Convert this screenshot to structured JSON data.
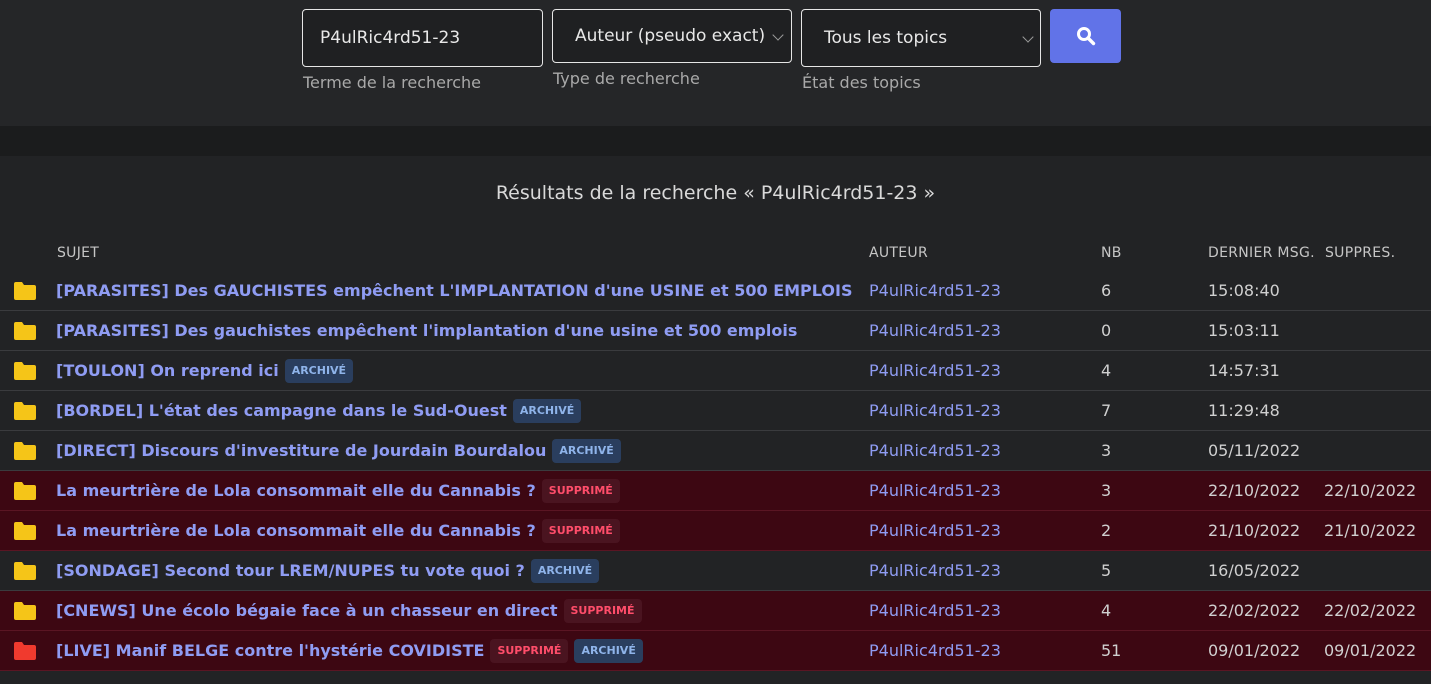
{
  "search": {
    "term_value": "P4ulRic4rd51-23",
    "term_caption": "Terme de la recherche",
    "type_value": "Auteur (pseudo exact)",
    "type_caption": "Type de recherche",
    "state_value": "Tous les topics",
    "state_caption": "État des topics",
    "button_icon": "search-icon"
  },
  "results": {
    "title": "Résultats de la recherche « P4ulRic4rd51-23 »",
    "headers": {
      "subject": "SUJET",
      "author": "AUTEUR",
      "nb": "NB",
      "last": "DERNIER MSG.",
      "deleted": "SUPPRES."
    },
    "rows": [
      {
        "subject": "[PARASITES] Des GAUCHISTES empêchent L'IMPLANTATION d'une USINE et 500 EMPLOIS",
        "author": "P4ulRic4rd51-23",
        "nb": "6",
        "last": "15:08:40",
        "deleted_date": "",
        "badges": [],
        "deleted": false,
        "folder_color": "#f5c518"
      },
      {
        "subject": "[PARASITES] Des gauchistes empêchent l'implantation d'une usine et 500 emplois",
        "author": "P4ulRic4rd51-23",
        "nb": "0",
        "last": "15:03:11",
        "deleted_date": "",
        "badges": [],
        "deleted": false,
        "folder_color": "#f5c518"
      },
      {
        "subject": "[TOULON] On reprend ici",
        "author": "P4ulRic4rd51-23",
        "nb": "4",
        "last": "14:57:31",
        "deleted_date": "",
        "badges": [
          "ARCHIVÉ"
        ],
        "deleted": false,
        "folder_color": "#f5c518"
      },
      {
        "subject": "[BORDEL] L'état des campagne dans le Sud-Ouest",
        "author": "P4ulRic4rd51-23",
        "nb": "7",
        "last": "11:29:48",
        "deleted_date": "",
        "badges": [
          "ARCHIVÉ"
        ],
        "deleted": false,
        "folder_color": "#f5c518"
      },
      {
        "subject": "[DIRECT] Discours d'investiture de Jourdain Bourdalou",
        "author": "P4ulRic4rd51-23",
        "nb": "3",
        "last": "05/11/2022",
        "deleted_date": "",
        "badges": [
          "ARCHIVÉ"
        ],
        "deleted": false,
        "folder_color": "#f5c518"
      },
      {
        "subject": "La meurtrière de Lola consommait elle du Cannabis ?",
        "author": "P4ulRic4rd51-23",
        "nb": "3",
        "last": "22/10/2022",
        "deleted_date": "22/10/2022",
        "badges": [
          "SUPPRIMÉ"
        ],
        "deleted": true,
        "folder_color": "#f5c518"
      },
      {
        "subject": "La meurtrière de Lola consommait elle du Cannabis ?",
        "author": "P4ulRic4rd51-23",
        "nb": "2",
        "last": "21/10/2022",
        "deleted_date": "21/10/2022",
        "badges": [
          "SUPPRIMÉ"
        ],
        "deleted": true,
        "folder_color": "#f5c518"
      },
      {
        "subject": "[SONDAGE] Second tour LREM/NUPES tu vote quoi ?",
        "author": "P4ulRic4rd51-23",
        "nb": "5",
        "last": "16/05/2022",
        "deleted_date": "",
        "badges": [
          "ARCHIVÉ"
        ],
        "deleted": false,
        "folder_color": "#f5c518"
      },
      {
        "subject": "[CNEWS] Une écolo bégaie face à un chasseur en direct",
        "author": "P4ulRic4rd51-23",
        "nb": "4",
        "last": "22/02/2022",
        "deleted_date": "22/02/2022",
        "badges": [
          "SUPPRIMÉ"
        ],
        "deleted": true,
        "folder_color": "#f5c518"
      },
      {
        "subject": "[LIVE] Manif BELGE contre l'hystérie COVIDISTE",
        "author": "P4ulRic4rd51-23",
        "nb": "51",
        "last": "09/01/2022",
        "deleted_date": "09/01/2022",
        "badges": [
          "SUPPRIMÉ",
          "ARCHIVÉ"
        ],
        "deleted": true,
        "folder_color": "#f03a2e"
      }
    ]
  }
}
